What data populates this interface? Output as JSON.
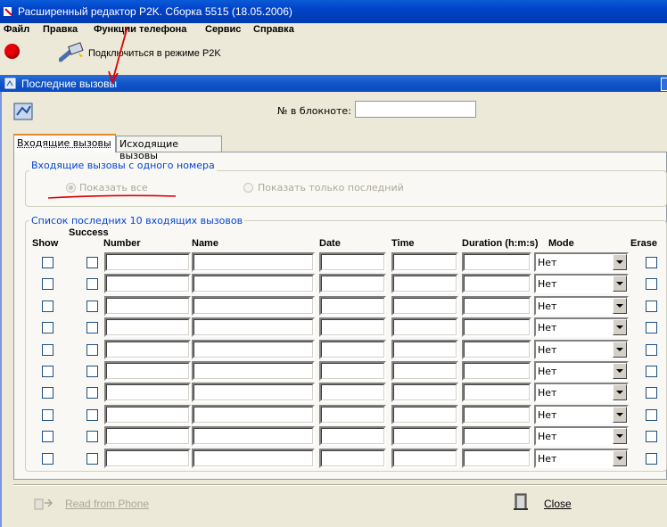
{
  "app": {
    "title": "Расширенный редактор P2K. Сборка 5515 (18.05.2006)",
    "menu": [
      "Файл",
      "Правка",
      "Функции телефона",
      "Сервис",
      "Справка"
    ],
    "toolbar": {
      "connect_label": "Подключиться в режиме P2K"
    }
  },
  "dialog": {
    "title": "Последние вызовы",
    "notebook_label": "№ в блокноте:",
    "notebook_value": "",
    "tabs": [
      "Входящие вызовы",
      "Исходящие вызовы"
    ],
    "active_tab": 0,
    "group_single": {
      "label": "Входящие вызовы с одного номера",
      "option_all": "Показать все",
      "option_last": "Показать только последний",
      "selected": "option_all"
    },
    "group_list": {
      "label": "Список последних 10 входящих вызовов",
      "headers": {
        "show": "Show",
        "success": "Success",
        "number": "Number",
        "name": "Name",
        "date": "Date",
        "time": "Time",
        "duration": "Duration (h:m:s)",
        "mode": "Mode",
        "erase": "Erase"
      },
      "rows": [
        {
          "mode": "Нет"
        },
        {
          "mode": "Нет"
        },
        {
          "mode": "Нет"
        },
        {
          "mode": "Нет"
        },
        {
          "mode": "Нет"
        },
        {
          "mode": "Нет"
        },
        {
          "mode": "Нет"
        },
        {
          "mode": "Нет"
        },
        {
          "mode": "Нет"
        },
        {
          "mode": "Нет"
        }
      ]
    },
    "buttons": {
      "read": "Read from Phone",
      "close": "Close"
    }
  },
  "colors": {
    "title_bar": "#0142c8",
    "group_label": "#0046d5",
    "annotation_red": "#e00000"
  },
  "icons": [
    "app-icon",
    "record-icon",
    "usb-cable-icon",
    "dialog-icon",
    "phone-icon",
    "read-icon",
    "door-exit-icon"
  ]
}
